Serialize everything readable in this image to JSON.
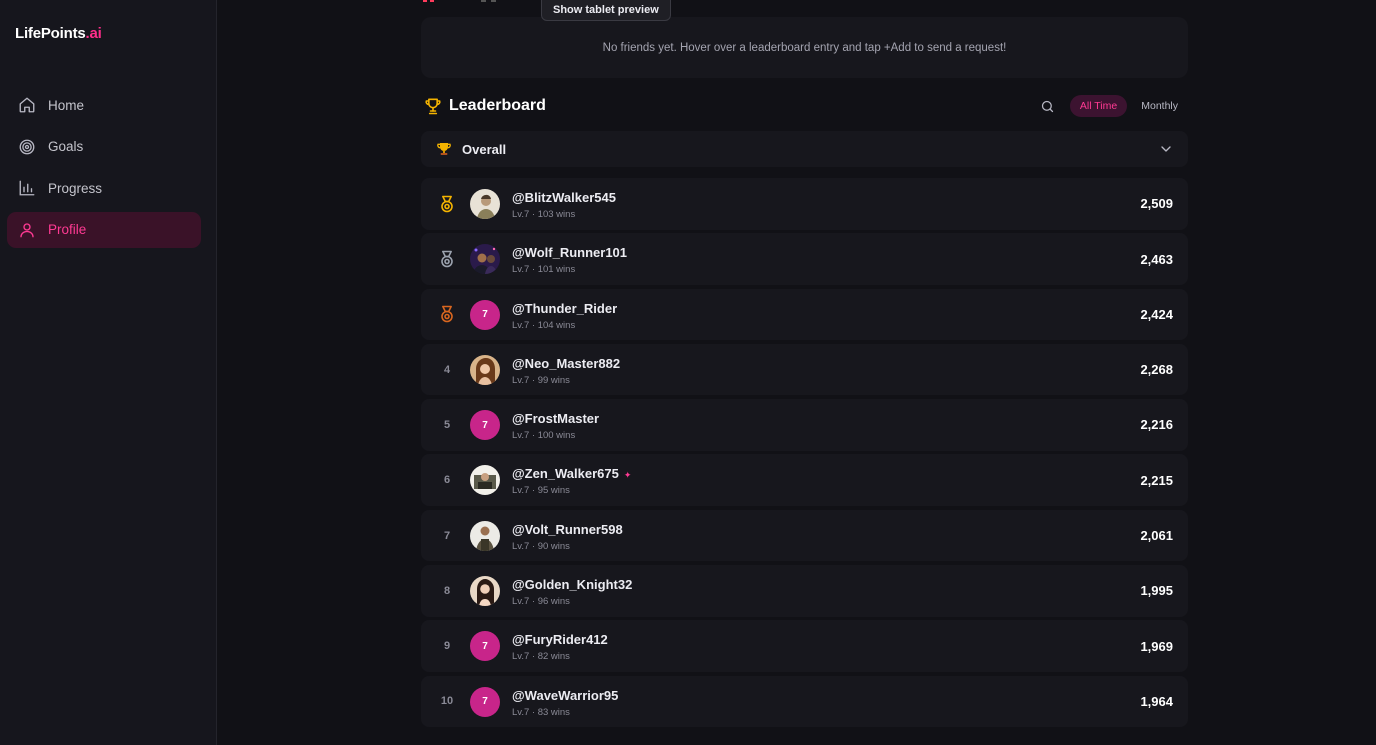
{
  "app": {
    "logo_main": "LifePoints",
    "logo_accent": ".ai"
  },
  "sidebar": {
    "items": [
      {
        "label": "Home",
        "icon": "home-icon",
        "active": false
      },
      {
        "label": "Goals",
        "icon": "target-icon",
        "active": false
      },
      {
        "label": "Progress",
        "icon": "bar-chart-icon",
        "active": false
      },
      {
        "label": "Profile",
        "icon": "user-icon",
        "active": true
      }
    ]
  },
  "tooltip": {
    "text": "Show tablet preview"
  },
  "friends": {
    "empty_message": "No friends yet. Hover over a leaderboard entry and tap +Add to send a request!"
  },
  "leaderboard": {
    "title": "Leaderboard",
    "tabs": {
      "all_time": "All Time",
      "monthly": "Monthly",
      "active": "All Time"
    },
    "category": {
      "label": "Overall"
    },
    "rows": [
      {
        "rank": "1",
        "medal": "gold",
        "avatar": "photo",
        "username": "@BlitzWalker545",
        "stats": "Lv.7 · 103 wins",
        "score": "2,509"
      },
      {
        "rank": "2",
        "medal": "silver",
        "avatar": "photo",
        "username": "@Wolf_Runner101",
        "stats": "Lv.7 · 101 wins",
        "score": "2,463"
      },
      {
        "rank": "3",
        "medal": "bronze",
        "avatar": "7",
        "username": "@Thunder_Rider",
        "stats": "Lv.7 · 104 wins",
        "score": "2,424"
      },
      {
        "rank": "4",
        "medal": "",
        "avatar": "photo",
        "username": "@Neo_Master882",
        "stats": "Lv.7 · 99 wins",
        "score": "2,268"
      },
      {
        "rank": "5",
        "medal": "",
        "avatar": "7",
        "username": "@FrostMaster",
        "stats": "Lv.7 · 100 wins",
        "score": "2,216"
      },
      {
        "rank": "6",
        "medal": "",
        "avatar": "photo",
        "username": "@Zen_Walker675",
        "stats": "Lv.7 · 95 wins",
        "score": "2,215",
        "sparkle": "✦"
      },
      {
        "rank": "7",
        "medal": "",
        "avatar": "photo",
        "username": "@Volt_Runner598",
        "stats": "Lv.7 · 90 wins",
        "score": "2,061"
      },
      {
        "rank": "8",
        "medal": "",
        "avatar": "photo",
        "username": "@Golden_Knight32",
        "stats": "Lv.7 · 96 wins",
        "score": "1,995"
      },
      {
        "rank": "9",
        "medal": "",
        "avatar": "7",
        "username": "@FuryRider412",
        "stats": "Lv.7 · 82 wins",
        "score": "1,969"
      },
      {
        "rank": "10",
        "medal": "",
        "avatar": "7",
        "username": "@WaveWarrior95",
        "stats": "Lv.7 · 83 wins",
        "score": "1,964"
      }
    ]
  },
  "colors": {
    "accent": "#ff2d8a",
    "gold": "#f5b400",
    "silver": "#9ca3af",
    "bronze": "#d9661f",
    "level_badge": "#c8258a"
  }
}
